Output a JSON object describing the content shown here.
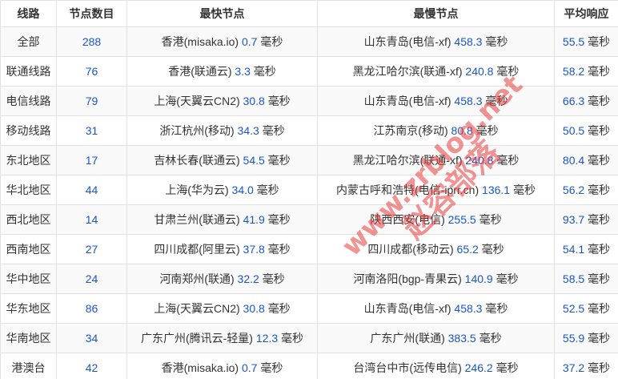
{
  "table": {
    "headers": [
      "线路",
      "节点数目",
      "最快节点",
      "最慢节点",
      "平均响应"
    ],
    "rows": [
      {
        "route": "全部",
        "count": "288",
        "fast_name": "香港(misaka.io)",
        "fast_ms": "0.7",
        "slow_name": "山东青岛(电信-xf)",
        "slow_ms": "458.3",
        "avg_ms": "55.5"
      },
      {
        "route": "联通线路",
        "count": "76",
        "fast_name": "香港(联通云)",
        "fast_ms": "3.3",
        "slow_name": "黑龙江哈尔滨(联通-xf)",
        "slow_ms": "240.8",
        "avg_ms": "58.2"
      },
      {
        "route": "电信线路",
        "count": "79",
        "fast_name": "上海(天翼云CN2)",
        "fast_ms": "30.8",
        "slow_name": "山东青岛(电信-xf)",
        "slow_ms": "458.3",
        "avg_ms": "66.3"
      },
      {
        "route": "移动线路",
        "count": "31",
        "fast_name": "浙江杭州(移动)",
        "fast_ms": "34.3",
        "slow_name": "江苏南京(移动)",
        "slow_ms": "80.8",
        "avg_ms": "50.5"
      },
      {
        "route": "东北地区",
        "count": "17",
        "fast_name": "吉林长春(联通云)",
        "fast_ms": "54.5",
        "slow_name": "黑龙江哈尔滨(联通-xf)",
        "slow_ms": "240.8",
        "avg_ms": "80.4"
      },
      {
        "route": "华北地区",
        "count": "44",
        "fast_name": "上海(华为云)",
        "fast_ms": "34.0",
        "slow_name": "内蒙古呼和浩特(电信-iprr.cn)",
        "slow_ms": "136.1",
        "avg_ms": "56.2"
      },
      {
        "route": "西北地区",
        "count": "14",
        "fast_name": "甘肃兰州(联通云)",
        "fast_ms": "41.9",
        "slow_name": "陕西西安(电信)",
        "slow_ms": "255.5",
        "avg_ms": "93.7"
      },
      {
        "route": "西南地区",
        "count": "27",
        "fast_name": "四川成都(阿里云)",
        "fast_ms": "37.8",
        "slow_name": "四川成都(移动云)",
        "slow_ms": "65.2",
        "avg_ms": "54.1"
      },
      {
        "route": "华中地区",
        "count": "24",
        "fast_name": "河南郑州(联通)",
        "fast_ms": "32.2",
        "slow_name": "河南洛阳(bgp-青果云)",
        "slow_ms": "140.9",
        "avg_ms": "58.5"
      },
      {
        "route": "华东地区",
        "count": "86",
        "fast_name": "上海(天翼云CN2)",
        "fast_ms": "30.8",
        "slow_name": "山东青岛(电信-xf)",
        "slow_ms": "458.3",
        "avg_ms": "52.5"
      },
      {
        "route": "华南地区",
        "count": "34",
        "fast_name": "广东广州(腾讯云-轻量)",
        "fast_ms": "12.3",
        "slow_name": "广东广州(联通)",
        "slow_ms": "383.5",
        "avg_ms": "55.9"
      },
      {
        "route": "港澳台",
        "count": "42",
        "fast_name": "香港(misaka.io)",
        "fast_ms": "0.7",
        "slow_name": "台湾台中市(远传电信)",
        "slow_ms": "246.2",
        "avg_ms": "37.2"
      }
    ],
    "unit": "毫秒"
  },
  "watermark": {
    "line1": "www.zrblog.net",
    "line2": "赵容部落",
    "color": "#e83c3c"
  },
  "colors": {
    "number": "#1a56c8",
    "border": "#e2e2e2",
    "stripe": "#f9f9f9"
  }
}
